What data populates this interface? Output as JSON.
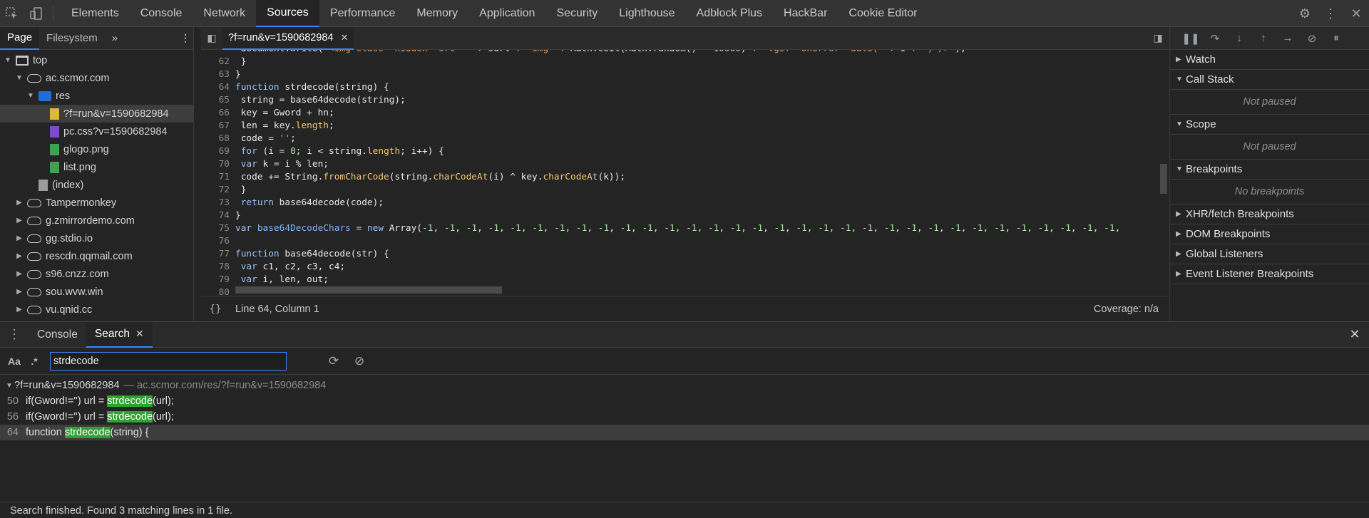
{
  "topbar": {
    "tabs": [
      "Elements",
      "Console",
      "Network",
      "Sources",
      "Performance",
      "Memory",
      "Application",
      "Security",
      "Lighthouse",
      "Adblock Plus",
      "HackBar",
      "Cookie Editor"
    ],
    "active_tab": "Sources"
  },
  "navigator": {
    "tabs": [
      "Page",
      "Filesystem"
    ],
    "tree": [
      {
        "label": "top",
        "icon": "frame-icon"
      },
      {
        "label": "ac.scmor.com",
        "icon": "cloud-icon"
      },
      {
        "label": "res",
        "icon": "folder-icon"
      },
      {
        "label": "?f=run&v=1590682984",
        "icon": "script-file-icon"
      },
      {
        "label": "pc.css?v=1590682984",
        "icon": "stylesheet-file-icon"
      },
      {
        "label": "glogo.png",
        "icon": "image-file-icon"
      },
      {
        "label": "list.png",
        "icon": "image-file-icon"
      },
      {
        "label": "(index)",
        "icon": "document-file-icon"
      },
      {
        "label": "Tampermonkey",
        "icon": "cloud-icon"
      },
      {
        "label": "g.zmirrordemo.com",
        "icon": "cloud-icon"
      },
      {
        "label": "gg.stdio.io",
        "icon": "cloud-icon"
      },
      {
        "label": "rescdn.qqmail.com",
        "icon": "cloud-icon"
      },
      {
        "label": "s96.cnzz.com",
        "icon": "cloud-icon"
      },
      {
        "label": "sou.wvw.win",
        "icon": "cloud-icon"
      },
      {
        "label": "vu.qnid.cc",
        "icon": "cloud-icon"
      }
    ]
  },
  "editor": {
    "file_tab": "?f=run&v=1590682984",
    "lines": [
      {
        "n": "62",
        "text": " }"
      },
      {
        "n": "63",
        "text": "}"
      },
      {
        "n": "64",
        "text": "function strdecode(string) {"
      },
      {
        "n": "65",
        "text": " string = base64decode(string);"
      },
      {
        "n": "66",
        "text": " key = Gword + hn;"
      },
      {
        "n": "67",
        "text": " len = key.length;"
      },
      {
        "n": "68",
        "text": " code = '';"
      },
      {
        "n": "69",
        "text": " for (i = 0; i < string.length; i++) {"
      },
      {
        "n": "70",
        "text": " var k = i % len;"
      },
      {
        "n": "71",
        "text": " code += String.fromCharCode(string.charCodeAt(i) ^ key.charCodeAt(k));"
      },
      {
        "n": "72",
        "text": " }"
      },
      {
        "n": "73",
        "text": " return base64decode(code);"
      },
      {
        "n": "74",
        "text": "}"
      },
      {
        "n": "75",
        "text": "var base64DecodeChars = new Array(-1, -1, -1, -1, -1, -1, -1, -1, -1, -1, -1, -1, -1, -1, -1, -1, -1, -1, -1, -1, -1, -1, -1, -1, -1, -1, -1, -1, -1, -1, -1, -1,"
      },
      {
        "n": "76",
        "text": ""
      },
      {
        "n": "77",
        "text": "function base64decode(str) {"
      },
      {
        "n": "78",
        "text": " var c1, c2, c3, c4;"
      },
      {
        "n": "79",
        "text": " var i, len, out;"
      },
      {
        "n": "80",
        "text": ""
      }
    ],
    "status_position": "Line 64, Column 1",
    "coverage": "Coverage: n/a"
  },
  "debugger": {
    "sections": [
      {
        "title": "Watch",
        "expanded": false,
        "body": ""
      },
      {
        "title": "Call Stack",
        "expanded": true,
        "body": "Not paused"
      },
      {
        "title": "Scope",
        "expanded": true,
        "body": "Not paused"
      },
      {
        "title": "Breakpoints",
        "expanded": true,
        "body": "No breakpoints"
      },
      {
        "title": "XHR/fetch Breakpoints",
        "expanded": false,
        "body": ""
      },
      {
        "title": "DOM Breakpoints",
        "expanded": false,
        "body": ""
      },
      {
        "title": "Global Listeners",
        "expanded": false,
        "body": ""
      },
      {
        "title": "Event Listener Breakpoints",
        "expanded": false,
        "body": ""
      }
    ]
  },
  "drawer": {
    "tabs": [
      "Console",
      "Search"
    ],
    "active_tab": "Search",
    "search": {
      "case_label": "Aa",
      "regex_label": ".*",
      "query": "strdecode"
    },
    "results": {
      "file": "?f=run&v=1590682984",
      "path": "— ac.scmor.com/res/?f=run&v=1590682984",
      "matches": [
        {
          "line": "50",
          "before": "if(Gword!='') url = ",
          "match": "strdecode",
          "after": "(url);"
        },
        {
          "line": "56",
          "before": "if(Gword!='') url = ",
          "match": "strdecode",
          "after": "(url);"
        },
        {
          "line": "64",
          "before": "function ",
          "match": "strdecode",
          "after": "(string) {"
        }
      ]
    },
    "status": "Search finished.  Found 3 matching lines in 1 file."
  }
}
